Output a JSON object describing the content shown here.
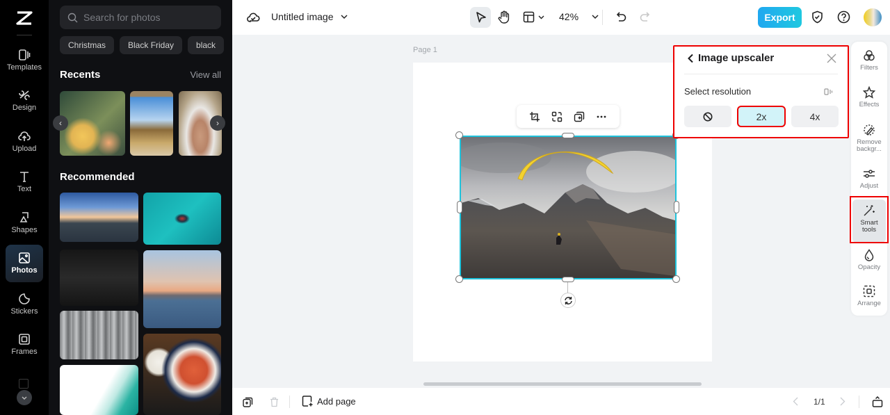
{
  "sidebar": {
    "items": [
      {
        "label": "Templates",
        "icon": "templates-icon"
      },
      {
        "label": "Design",
        "icon": "design-icon"
      },
      {
        "label": "Upload",
        "icon": "upload-icon"
      },
      {
        "label": "Text",
        "icon": "text-icon"
      },
      {
        "label": "Shapes",
        "icon": "shapes-icon"
      },
      {
        "label": "Photos",
        "icon": "photos-icon",
        "active": true
      },
      {
        "label": "Stickers",
        "icon": "stickers-icon"
      },
      {
        "label": "Frames",
        "icon": "frames-icon"
      }
    ]
  },
  "panel": {
    "search_placeholder": "Search for photos",
    "chips": [
      "Christmas",
      "Black Friday",
      "black"
    ],
    "recents_title": "Recents",
    "view_all": "View all",
    "recommended_title": "Recommended"
  },
  "topbar": {
    "title": "Untitled image",
    "zoom": "42%",
    "export_label": "Export"
  },
  "canvas": {
    "page_label": "Page 1"
  },
  "upscaler": {
    "title": "Image upscaler",
    "select_label": "Select resolution",
    "options": [
      "none",
      "2x",
      "4x"
    ],
    "selected": "2x"
  },
  "right_tools": [
    {
      "label": "Filters"
    },
    {
      "label": "Effects"
    },
    {
      "label": "Remove backgr..."
    },
    {
      "label": "Adjust"
    },
    {
      "label": "Smart tools",
      "selected": true
    },
    {
      "label": "Opacity"
    },
    {
      "label": "Arrange"
    }
  ],
  "bottombar": {
    "add_page": "Add page",
    "page_count": "1/1"
  },
  "colors": {
    "accent": "#1ec3dc",
    "export_start": "#20a8f0",
    "highlight": "#e00000"
  }
}
